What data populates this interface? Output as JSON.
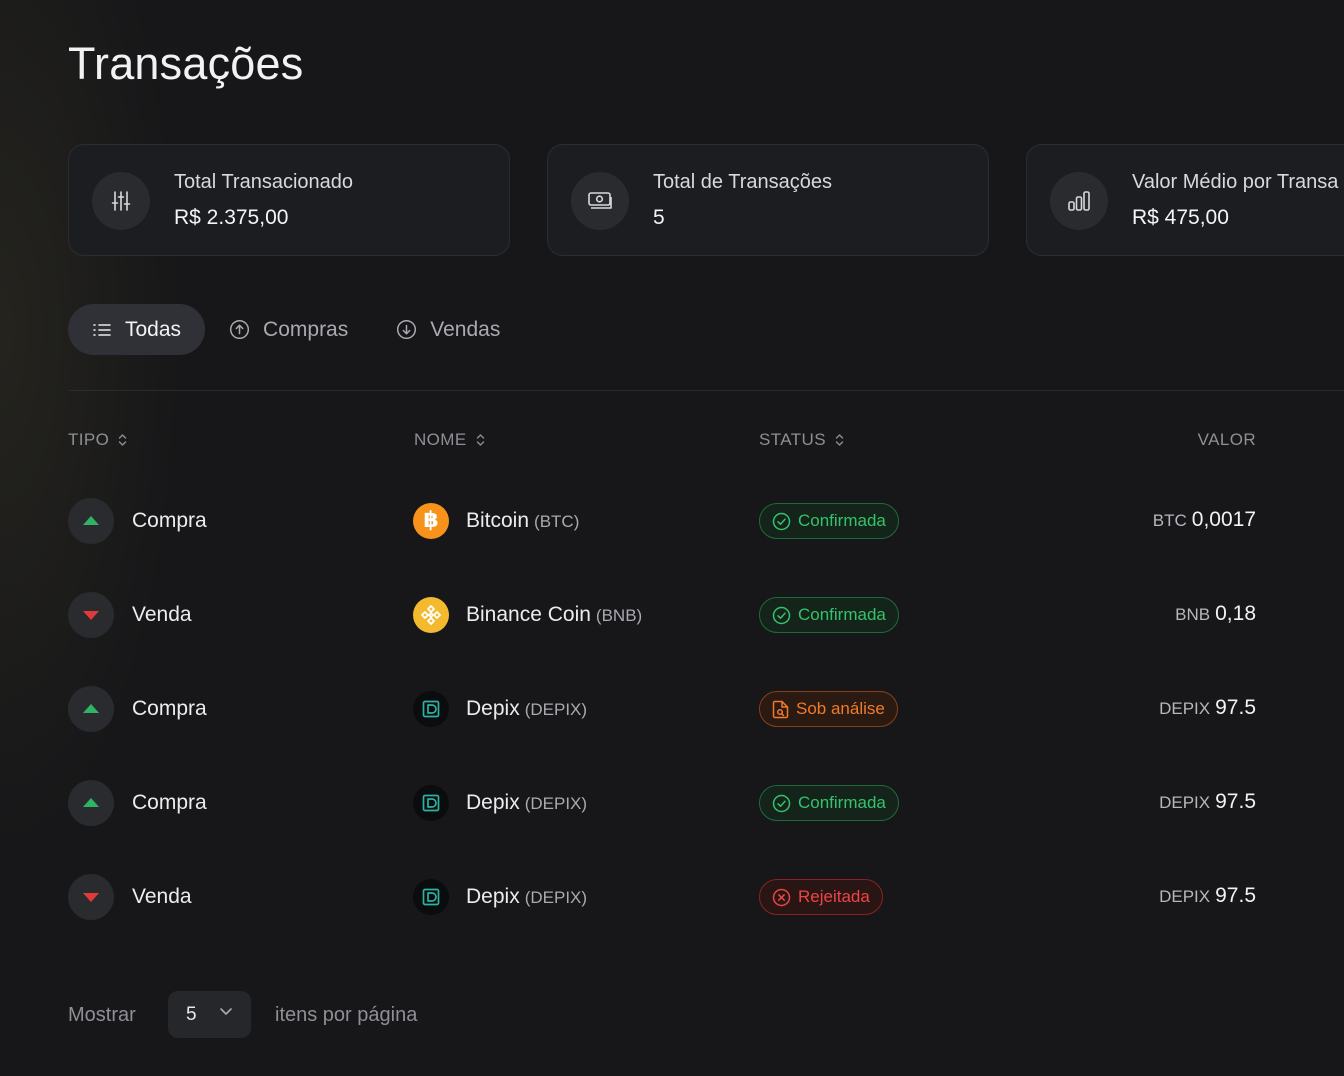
{
  "page": {
    "title": "Transações"
  },
  "summary": {
    "cards": [
      {
        "label": "Total Transacionado",
        "value": "R$ 2.375,00",
        "icon": "sliders-icon"
      },
      {
        "label": "Total de Transações",
        "value": "5",
        "icon": "money-icon"
      },
      {
        "label": "Valor Médio por Transa",
        "value": "R$ 475,00",
        "icon": "bar-chart-icon"
      }
    ]
  },
  "filters": {
    "all": "Todas",
    "buys": "Compras",
    "sells": "Vendas"
  },
  "table": {
    "headers": {
      "type": "TIPO",
      "name": "NOME",
      "status": "STATUS",
      "value": "VALOR"
    },
    "rows": [
      {
        "type": "Compra",
        "direction": "up",
        "coin": "Bitcoin",
        "symbol": "(BTC)",
        "coin_icon": "bitcoin-icon",
        "status": "Confirmada",
        "status_kind": "ok",
        "unit": "BTC",
        "amount": "0,0017"
      },
      {
        "type": "Venda",
        "direction": "down",
        "coin": "Binance Coin",
        "symbol": "(BNB)",
        "coin_icon": "bnb-icon",
        "status": "Confirmada",
        "status_kind": "ok",
        "unit": "BNB",
        "amount": "0,18"
      },
      {
        "type": "Compra",
        "direction": "up",
        "coin": "Depix",
        "symbol": "(DEPIX)",
        "coin_icon": "depix-icon",
        "status": "Sob análise",
        "status_kind": "warn",
        "unit": "DEPIX",
        "amount": "97.5"
      },
      {
        "type": "Compra",
        "direction": "up",
        "coin": "Depix",
        "symbol": "(DEPIX)",
        "coin_icon": "depix-icon",
        "status": "Confirmada",
        "status_kind": "ok",
        "unit": "DEPIX",
        "amount": "97.5"
      },
      {
        "type": "Venda",
        "direction": "down",
        "coin": "Depix",
        "symbol": "(DEPIX)",
        "coin_icon": "depix-icon",
        "status": "Rejeitada",
        "status_kind": "bad",
        "unit": "DEPIX",
        "amount": "97.5"
      }
    ]
  },
  "pagination": {
    "show_label": "Mostrar",
    "per_page": "5",
    "per_page_label": "itens por página"
  },
  "colors": {
    "up": "#2fb463",
    "down": "#e03a3a",
    "bitcoin": "#f7931a",
    "bnb": "#f3ba2f",
    "depix": "#2bb3a3",
    "ok": "#35c26c",
    "warn": "#f07a2c",
    "bad": "#ee4444"
  }
}
